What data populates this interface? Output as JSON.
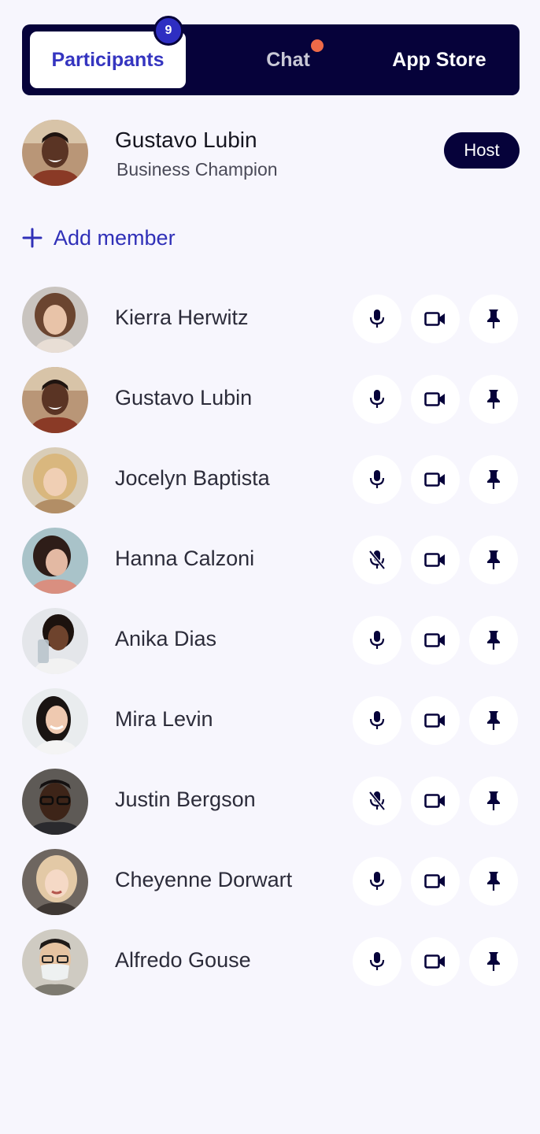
{
  "tabs": {
    "participants": "Participants",
    "participants_count": "9",
    "chat": "Chat",
    "app_store": "App Store"
  },
  "host": {
    "name": "Gustavo Lubin",
    "role": "Business Champion",
    "badge": "Host"
  },
  "add_member_label": "Add member",
  "participants": [
    {
      "name": "Kierra Herwitz",
      "mic": "on"
    },
    {
      "name": "Gustavo Lubin",
      "mic": "on"
    },
    {
      "name": "Jocelyn Baptista",
      "mic": "on"
    },
    {
      "name": "Hanna Calzoni",
      "mic": "off"
    },
    {
      "name": "Anika Dias",
      "mic": "on"
    },
    {
      "name": "Mira Levin",
      "mic": "on"
    },
    {
      "name": "Justin Bergson",
      "mic": "off"
    },
    {
      "name": "Cheyenne Dorwart",
      "mic": "on"
    },
    {
      "name": "Alfredo Gouse",
      "mic": "on"
    }
  ],
  "icons": {
    "add": "plus-icon",
    "mic_on": "microphone-icon",
    "mic_off": "microphone-muted-icon",
    "camera": "video-camera-icon",
    "pin": "pin-icon"
  },
  "colors": {
    "background": "#f7f6fd",
    "navy": "#06023a",
    "accent_blue": "#3030b8",
    "chat_dot": "#ee6a48"
  }
}
